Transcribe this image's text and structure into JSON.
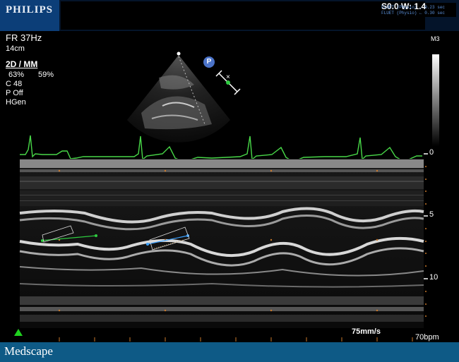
{
  "header": {
    "brand": "PHILIPS",
    "overlay_big": "S0.0 W: 1.4",
    "physio_line_1": "FLUET (Physio) ← 0.23 sec",
    "physio_line_2": "FLUET (Physio) ← 0.30 sec"
  },
  "params": {
    "frame_rate": "FR 37Hz",
    "depth": "14cm",
    "mode": "2D / MM",
    "gain_2d": "63%",
    "gain_mm": "59%",
    "compression": "C 48",
    "persistence": "P Off",
    "preset": "HGen"
  },
  "probe": {
    "label": "M3",
    "position_marker": "P"
  },
  "depth_scale": {
    "marks": [
      "0",
      "5",
      "10"
    ]
  },
  "footer": {
    "sweep_speed": "75mm/s",
    "heart_rate": "70bpm",
    "publisher": "Medscape"
  },
  "colors": {
    "ecg": "#48d848",
    "measure_green": "#2ecc40",
    "measure_blue": "#3aa0ff",
    "bottom_bar": "#0e5a86",
    "logo_bg": "#0c3e78"
  }
}
